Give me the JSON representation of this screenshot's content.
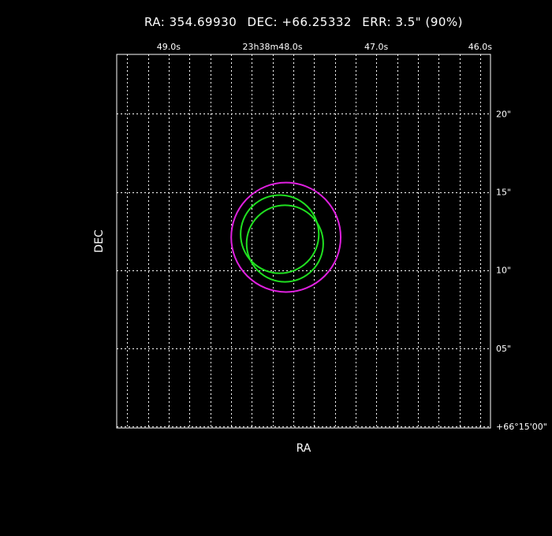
{
  "header": {
    "ra": "RA: 354.69930",
    "dec": "DEC: +66.25332",
    "err": "ERR: 3.5\" (90%)"
  },
  "chart_data": {
    "type": "scatter",
    "xlabel": "RA",
    "ylabel": "DEC",
    "grid": true,
    "x_ticks": [
      {
        "label": "49.0s",
        "value": 49.0
      },
      {
        "label": "23h38m48.0s",
        "value": 48.0
      },
      {
        "label": "47.0s",
        "value": 47.0
      },
      {
        "label": "46.0s",
        "value": 46.0
      }
    ],
    "y_ticks": [
      {
        "label": "20\"",
        "value": 20
      },
      {
        "label": "15\"",
        "value": 15
      },
      {
        "label": "10\"",
        "value": 10
      },
      {
        "label": "05\"",
        "value": 5
      },
      {
        "label": "+66°15'00\"",
        "value": 0
      }
    ],
    "xlim": [
      49.5,
      45.9
    ],
    "ylim": [
      -0.1,
      23.8
    ],
    "circles": [
      {
        "name": "",
        "ra_s": 47.87,
        "dec_as": 12.1,
        "radius_as": 3.5,
        "color": "#e020e0"
      },
      {
        "name": "",
        "ra_s": 47.93,
        "dec_as": 12.3,
        "radius_as": 2.5,
        "color": "#20e020"
      },
      {
        "name": "",
        "ra_s": 47.88,
        "dec_as": 11.7,
        "radius_as": 2.45,
        "color": "#20e020"
      }
    ]
  }
}
